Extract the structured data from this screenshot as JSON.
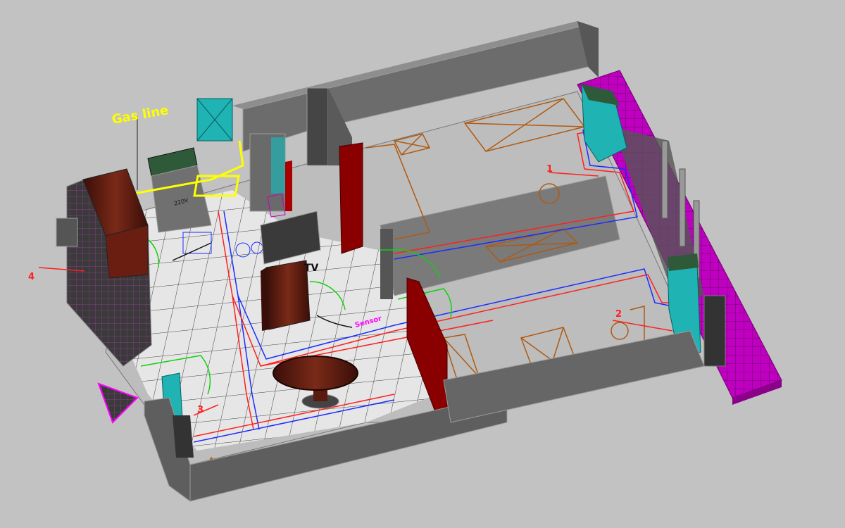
{
  "colors": {
    "background": "#c2c2c2",
    "wall_top": "#8e8e8e",
    "wall_side": "#5e5e5e",
    "wall_dark": "#404040",
    "floor_tile": "#e6e6e6",
    "grid_line": "#3a3a3a",
    "partition_red": "#8a0000",
    "cabinet_cyan": "#1fb3b3",
    "balcony_magenta": "#c000c0",
    "wood_brown": "#5a1a10",
    "furniture_outline": "#b05a10",
    "pipe_red": "#ff2020",
    "pipe_blue": "#1a2cff",
    "door_swing_green": "#10d010",
    "gas_line_yellow": "#ffff00",
    "label_red": "#ff2020",
    "label_magenta": "#ff00ff"
  },
  "labels": {
    "gas_line": "Gas line",
    "tv": "TV",
    "sensor": "Sensor",
    "marker_1": "1",
    "marker_2": "2",
    "marker_3": "3",
    "marker_4": "4",
    "small_note": "220V"
  },
  "icons": {
    "boiler": "boiler-box-icon",
    "dining_table": "oval-table-icon",
    "tv_unit": "tv-cabinet-icon",
    "triangle_marker": "triangle-marker-icon"
  }
}
